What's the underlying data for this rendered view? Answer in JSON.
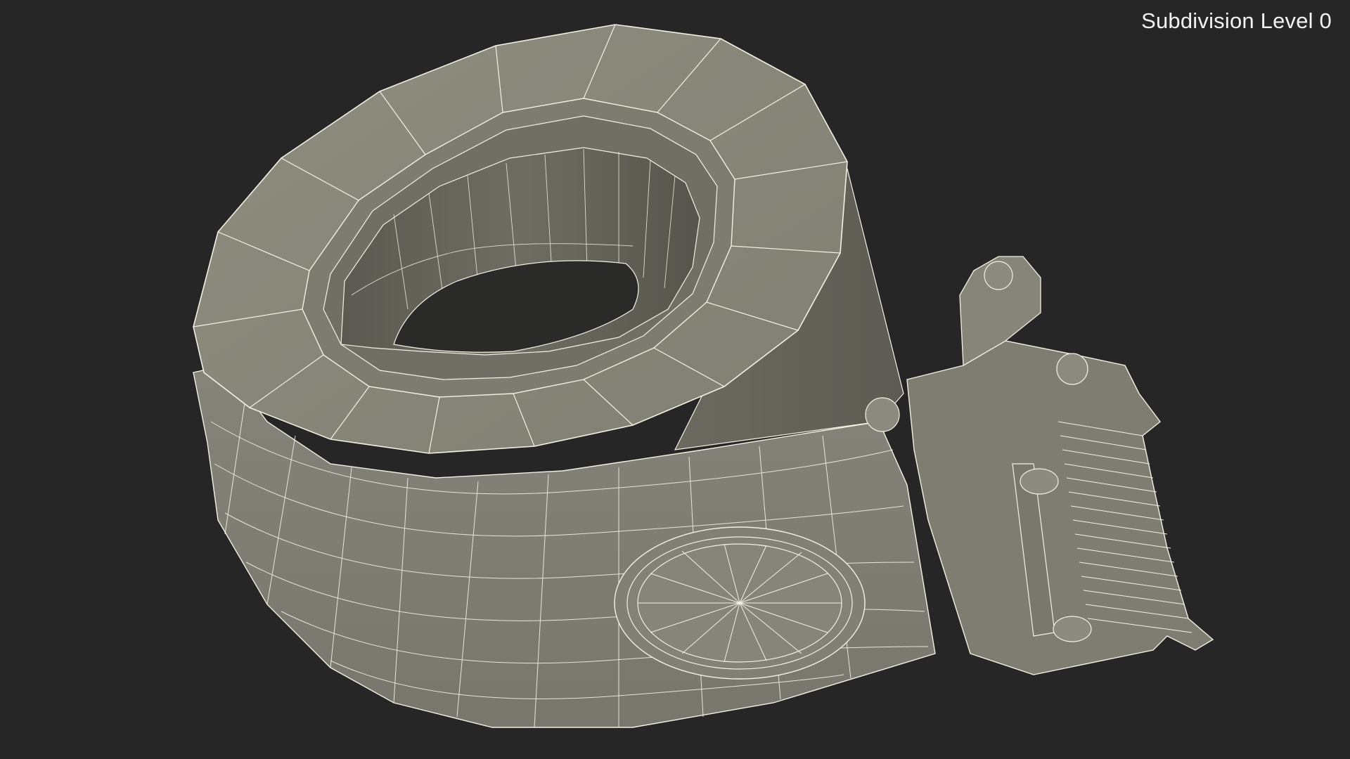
{
  "viewport": {
    "label": "Subdivision Level 0",
    "background": "#262626"
  },
  "model": {
    "subject": "tape dispenser wireframe",
    "surface_color": "#8c8c7e",
    "wire_color": "#f3f1e2"
  }
}
